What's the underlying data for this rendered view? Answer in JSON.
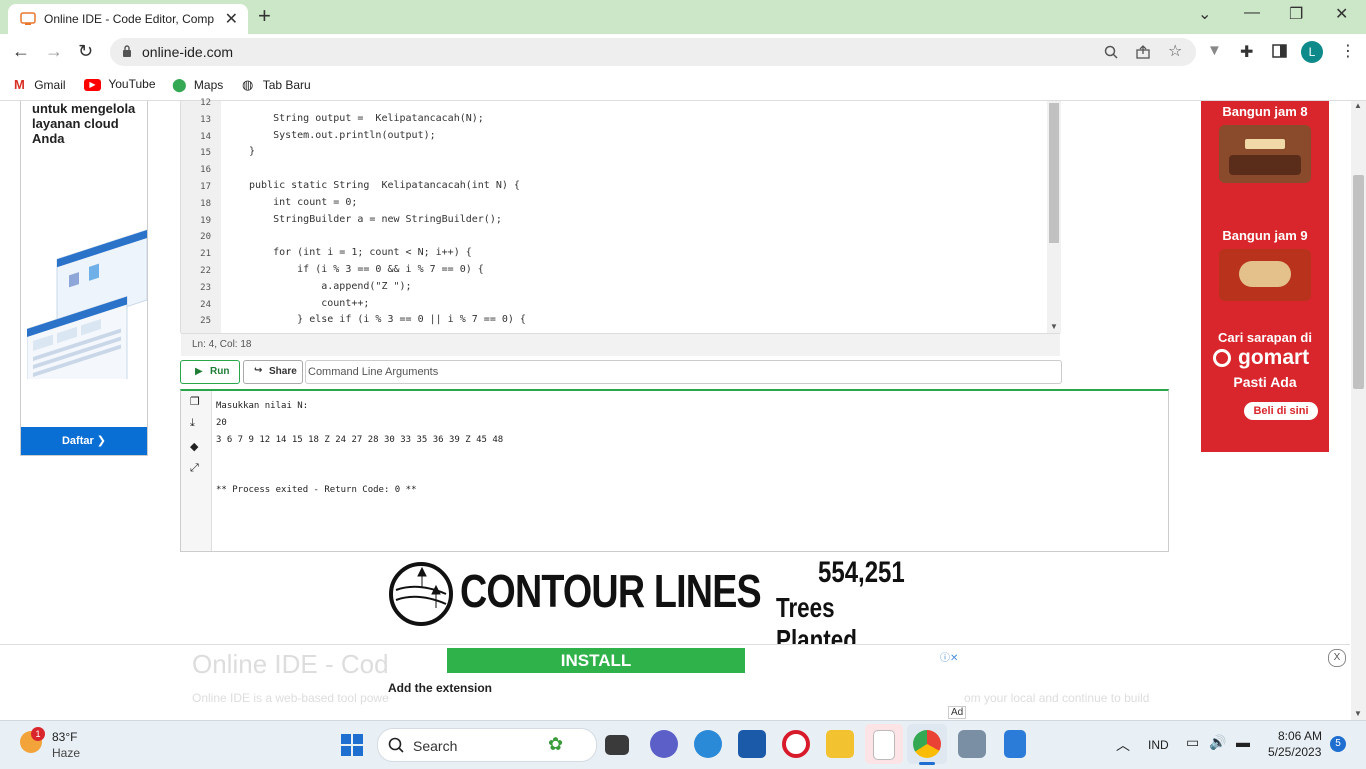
{
  "browser": {
    "tab_title": "Online IDE - Code Editor, Compil",
    "tab_close": "✕",
    "new_tab": "+",
    "url": "online-ide.com",
    "window_controls": [
      "⌄",
      "—",
      "❐",
      "✕"
    ],
    "profile_initial": "L",
    "bookmarks": [
      {
        "label": "Gmail",
        "icon": "gmail-icon"
      },
      {
        "label": "YouTube",
        "icon": "youtube-icon"
      },
      {
        "label": "Maps",
        "icon": "maps-icon"
      },
      {
        "label": "Tab Baru",
        "icon": "globe-icon"
      }
    ]
  },
  "left_ad": {
    "text_lines": [
      "untuk mengelola",
      "layanan cloud",
      "Anda"
    ],
    "button": "Daftar ❯"
  },
  "editor": {
    "lines": [
      {
        "n": "12",
        "code": ""
      },
      {
        "n": "13",
        "code": "    String output =  Kelipatancacah(N);"
      },
      {
        "n": "14",
        "code": "    System.out.println(output);"
      },
      {
        "n": "15",
        "code": "}"
      },
      {
        "n": "16",
        "code": ""
      },
      {
        "n": "17",
        "code": "public static String  Kelipatancacah(int N) {"
      },
      {
        "n": "18",
        "code": "    int count = 0;"
      },
      {
        "n": "19",
        "code": "    StringBuilder a = new StringBuilder();"
      },
      {
        "n": "20",
        "code": ""
      },
      {
        "n": "21",
        "code": "    for (int i = 1; count < N; i++) {"
      },
      {
        "n": "22",
        "code": "        if (i % 3 == 0 && i % 7 == 0) {"
      },
      {
        "n": "23",
        "code": "            a.append(\"Z \");"
      },
      {
        "n": "24",
        "code": "            count++;"
      },
      {
        "n": "25",
        "code": "        } else if (i % 3 == 0 || i % 7 == 0) {"
      }
    ],
    "status": "Ln: 4,  Col: 18",
    "run_label": "Run",
    "share_label": "Share",
    "args_placeholder": "Command Line Arguments"
  },
  "console": {
    "lines": [
      "Masukkan nilai N:",
      "20",
      "3 6 7 9 12 14 15 18 Z 24 27 28 30 33 35 36 39 Z 45 48",
      "",
      "",
      "** Process exited - Return Code: 0 **"
    ]
  },
  "right_ad": {
    "line1": "Bangun jam 8",
    "line2": "Bangun jam 9",
    "line3": "Cari sarapan di",
    "brand": "gomart",
    "line4": "Pasti Ada",
    "button": "Beli di sini",
    "colors": {
      "background": "#d9262c"
    }
  },
  "banner": {
    "brand": "CONTOUR LINES",
    "count": "554,251",
    "caption": "Trees Planted..."
  },
  "bottom_ad": {
    "ghost_heading": "Online IDE - Cod",
    "ghost_text_left": "Online IDE is a web-based tool powe",
    "ghost_text_right": "om your local and continue to build",
    "install_label": "INSTALL",
    "add_extension": "Add the extension",
    "ad_label": "Ad",
    "close": "X"
  },
  "taskbar": {
    "weather_badge": "1",
    "temperature": "83°F",
    "condition": "Haze",
    "search": "Search",
    "language": "IND",
    "time": "8:06 AM",
    "date": "5/25/2023",
    "notifications": "5"
  }
}
